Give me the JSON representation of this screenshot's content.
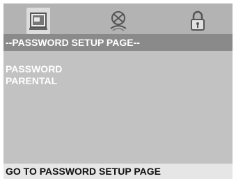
{
  "tabs": [
    {
      "icon": "video-setup-icon",
      "selected": true
    },
    {
      "icon": "audio-setup-icon",
      "selected": false
    },
    {
      "icon": "lock-icon",
      "selected": false
    }
  ],
  "header": {
    "title": "--PASSWORD SETUP PAGE--"
  },
  "menu": {
    "items": [
      {
        "label": "PASSWORD"
      },
      {
        "label": "PARENTAL"
      }
    ]
  },
  "status": {
    "text": "GO TO PASSWORD SETUP PAGE"
  },
  "colors": {
    "screen_bg": "#c2c2c2",
    "header_bg": "#8a8a8a",
    "status_bg": "#e6e6e6",
    "menu_text": "#ffffff"
  }
}
